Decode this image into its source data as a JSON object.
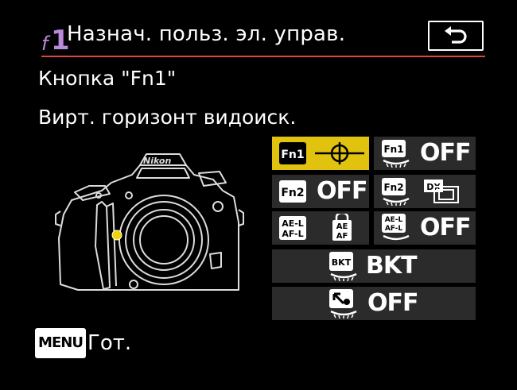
{
  "header": {
    "menu_letter": "f",
    "menu_number": "1",
    "title": "Назнач. польз. эл. управ.",
    "back_icon": "return-arrow-icon"
  },
  "selection": {
    "control": "Кнопка \"Fn1\"",
    "assignment": "Вирт. горизонт видоиск."
  },
  "camera": {
    "brand": "Nikon"
  },
  "controls": {
    "fn1_press": {
      "label": "Fn1",
      "icon": "virtual-horizon-icon"
    },
    "fn1_dial": {
      "label": "Fn1",
      "value": "OFF"
    },
    "fn2_press": {
      "label": "Fn2",
      "value": "OFF"
    },
    "fn2_dial": {
      "label": "Fn2",
      "icon": "dx-crop-icon",
      "dx_text": "DX"
    },
    "ael_press": {
      "label_top": "AE-L",
      "label_bottom": "AF-L",
      "icon_top": "AE",
      "icon_bottom": "AF"
    },
    "ael_dial": {
      "label_top": "AE-L",
      "label_bottom": "AF-L",
      "value": "OFF"
    },
    "bkt_dial": {
      "label": "BKT",
      "value": "BKT"
    },
    "movie_dial": {
      "icon": "movie-record-button-icon",
      "value": "OFF"
    }
  },
  "footer": {
    "menu_key": "MENU",
    "done_label": "Гот."
  },
  "colors": {
    "accent": "#b98ad9",
    "selected": "#e0c20f",
    "rule": "#d9463a"
  }
}
